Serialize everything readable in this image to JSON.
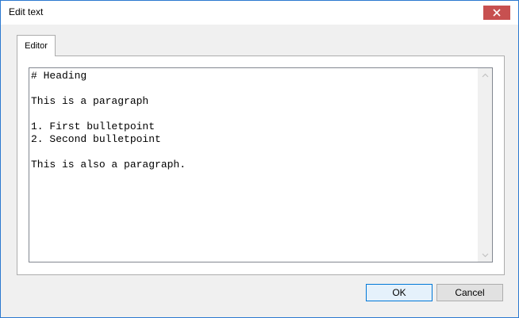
{
  "window": {
    "title": "Edit text",
    "close_icon": "close-icon",
    "close_color": "#c75050",
    "border_color": "#2b79d0"
  },
  "tabs": [
    {
      "label": "Editor",
      "active": true
    }
  ],
  "editor": {
    "content": "# Heading\n\nThis is a paragraph\n\n1. First bulletpoint\n2. Second bulletpoint\n\nThis is also a paragraph.",
    "scroll_up_icon": "chevron-up-icon",
    "scroll_down_icon": "chevron-down-icon"
  },
  "buttons": {
    "ok_label": "OK",
    "cancel_label": "Cancel"
  }
}
